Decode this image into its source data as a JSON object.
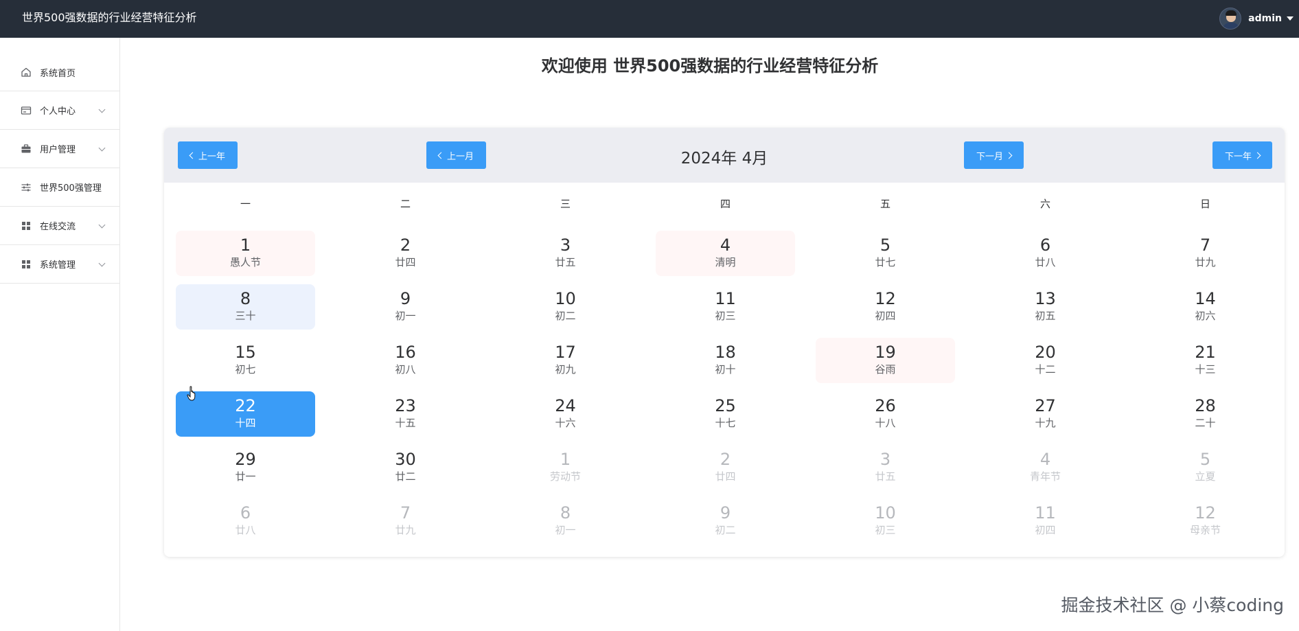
{
  "app": {
    "title": "世界500强数据的行业经营特征分析"
  },
  "user": {
    "name": "admin"
  },
  "sidebar": {
    "items": [
      {
        "label": "系统首页",
        "icon": "home-icon",
        "has_arrow": false
      },
      {
        "label": "个人中心",
        "icon": "id-card-icon",
        "has_arrow": true
      },
      {
        "label": "用户管理",
        "icon": "briefcase-icon",
        "has_arrow": true
      },
      {
        "label": "世界500强管理",
        "icon": "sliders-icon",
        "has_arrow": false
      },
      {
        "label": "在线交流",
        "icon": "grid-icon",
        "has_arrow": true
      },
      {
        "label": "系统管理",
        "icon": "grid-icon",
        "has_arrow": true
      }
    ]
  },
  "main": {
    "title": "欢迎使用 世界500强数据的行业经营特征分析"
  },
  "calendar": {
    "prev_year": "上一年",
    "prev_month": "上一月",
    "next_month": "下一月",
    "next_year": "下一年",
    "month_title": "2024年 4月",
    "weekdays": [
      "一",
      "二",
      "三",
      "四",
      "五",
      "六",
      "日"
    ],
    "weeks": [
      [
        {
          "d": "1",
          "l": "愚人节",
          "s": "holiday"
        },
        {
          "d": "2",
          "l": "廿四"
        },
        {
          "d": "3",
          "l": "廿五"
        },
        {
          "d": "4",
          "l": "清明",
          "s": "holiday"
        },
        {
          "d": "5",
          "l": "廿七"
        },
        {
          "d": "6",
          "l": "廿八"
        },
        {
          "d": "7",
          "l": "廿九"
        }
      ],
      [
        {
          "d": "8",
          "l": "三十",
          "s": "today"
        },
        {
          "d": "9",
          "l": "初一"
        },
        {
          "d": "10",
          "l": "初二"
        },
        {
          "d": "11",
          "l": "初三"
        },
        {
          "d": "12",
          "l": "初四"
        },
        {
          "d": "13",
          "l": "初五"
        },
        {
          "d": "14",
          "l": "初六"
        }
      ],
      [
        {
          "d": "15",
          "l": "初七"
        },
        {
          "d": "16",
          "l": "初八"
        },
        {
          "d": "17",
          "l": "初九"
        },
        {
          "d": "18",
          "l": "初十"
        },
        {
          "d": "19",
          "l": "谷雨",
          "s": "holiday"
        },
        {
          "d": "20",
          "l": "十二"
        },
        {
          "d": "21",
          "l": "十三"
        }
      ],
      [
        {
          "d": "22",
          "l": "十四",
          "s": "selected"
        },
        {
          "d": "23",
          "l": "十五"
        },
        {
          "d": "24",
          "l": "十六"
        },
        {
          "d": "25",
          "l": "十七"
        },
        {
          "d": "26",
          "l": "十八"
        },
        {
          "d": "27",
          "l": "十九"
        },
        {
          "d": "28",
          "l": "二十"
        }
      ],
      [
        {
          "d": "29",
          "l": "廿一"
        },
        {
          "d": "30",
          "l": "廿二"
        },
        {
          "d": "1",
          "l": "劳动节",
          "s": "other"
        },
        {
          "d": "2",
          "l": "廿四",
          "s": "other"
        },
        {
          "d": "3",
          "l": "廿五",
          "s": "other"
        },
        {
          "d": "4",
          "l": "青年节",
          "s": "other"
        },
        {
          "d": "5",
          "l": "立夏",
          "s": "other"
        }
      ],
      [
        {
          "d": "6",
          "l": "廿八",
          "s": "other"
        },
        {
          "d": "7",
          "l": "廿九",
          "s": "other"
        },
        {
          "d": "8",
          "l": "初一",
          "s": "other"
        },
        {
          "d": "9",
          "l": "初二",
          "s": "other"
        },
        {
          "d": "10",
          "l": "初三",
          "s": "other"
        },
        {
          "d": "11",
          "l": "初四",
          "s": "other"
        },
        {
          "d": "12",
          "l": "母亲节",
          "s": "other"
        }
      ]
    ]
  },
  "watermark": "掘金技术社区 @ 小蔡coding",
  "colors": {
    "topbar": "#262e39",
    "primary": "#3a9cf7",
    "holiday_bg": "#fff6f6",
    "today_bg": "#ecf2fd"
  }
}
